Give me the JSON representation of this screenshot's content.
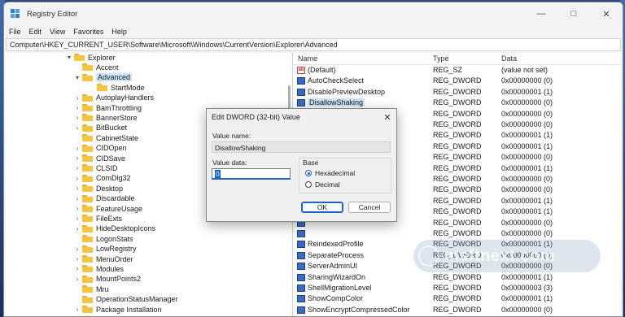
{
  "window": {
    "title": "Registry Editor",
    "controls": [
      "minimize",
      "maximize",
      "close"
    ]
  },
  "menu": [
    "File",
    "Edit",
    "View",
    "Favorites",
    "Help"
  ],
  "address": "Computer\\HKEY_CURRENT_USER\\Software\\Microsoft\\Windows\\CurrentVersion\\Explorer\\Advanced",
  "tree": {
    "items": [
      {
        "label": "Explorer",
        "chev": "▾"
      },
      {
        "label": "Accent",
        "chev": ""
      },
      {
        "label": "Advanced",
        "chev": "▾"
      },
      {
        "label": "StartMode",
        "chev": ""
      },
      {
        "label": "AutoplayHandlers",
        "chev": "›"
      },
      {
        "label": "BamThrottling",
        "chev": "›"
      },
      {
        "label": "BannerStore",
        "chev": "›"
      },
      {
        "label": "BitBucket",
        "chev": "›"
      },
      {
        "label": "CabinetState",
        "chev": ""
      },
      {
        "label": "CIDOpen",
        "chev": "›"
      },
      {
        "label": "CIDSave",
        "chev": "›"
      },
      {
        "label": "CLSID",
        "chev": "›"
      },
      {
        "label": "ComDlg32",
        "chev": "›"
      },
      {
        "label": "Desktop",
        "chev": "›"
      },
      {
        "label": "Discardable",
        "chev": "›"
      },
      {
        "label": "FeatureUsage",
        "chev": "›"
      },
      {
        "label": "FileExts",
        "chev": "›"
      },
      {
        "label": "HideDesktopIcons",
        "chev": "›"
      },
      {
        "label": "LogonStats",
        "chev": ""
      },
      {
        "label": "LowRegistry",
        "chev": "›"
      },
      {
        "label": "MenuOrder",
        "chev": "›"
      },
      {
        "label": "Modules",
        "chev": "›"
      },
      {
        "label": "MountPoints2",
        "chev": "›"
      },
      {
        "label": "Mru",
        "chev": ""
      },
      {
        "label": "OperationStatusManager",
        "chev": ""
      },
      {
        "label": "Package Installation",
        "chev": "›"
      }
    ]
  },
  "values_pane": {
    "headers": {
      "name": "Name",
      "type": "Type",
      "data": "Data"
    },
    "rows": [
      {
        "name": "(Default)",
        "type": "REG_SZ",
        "data": "(value not set)",
        "icon": "ab"
      },
      {
        "name": "AutoCheckSelect",
        "type": "REG_DWORD",
        "data": "0x00000000 (0)",
        "icon": "dword"
      },
      {
        "name": "DisablePreviewDesktop",
        "type": "REG_DWORD",
        "data": "0x00000001 (1)",
        "icon": "dword"
      },
      {
        "name": "DisallowShaking",
        "type": "REG_DWORD",
        "data": "0x00000000 (0)",
        "icon": "dword"
      },
      {
        "name": "",
        "type": "REG_DWORD",
        "data": "0x00000000 (0)",
        "icon": "dword"
      },
      {
        "name": "",
        "type": "REG_DWORD",
        "data": "0x00000000 (0)",
        "icon": "dword"
      },
      {
        "name": "",
        "type": "REG_DWORD",
        "data": "0x00000001 (1)",
        "icon": "dword"
      },
      {
        "name": "",
        "type": "REG_DWORD",
        "data": "0x00000001 (1)",
        "icon": "dword"
      },
      {
        "name": "",
        "type": "REG_DWORD",
        "data": "0x00000000 (0)",
        "icon": "dword"
      },
      {
        "name": "",
        "type": "REG_DWORD",
        "data": "0x00000001 (1)",
        "icon": "dword"
      },
      {
        "name": "",
        "type": "REG_DWORD",
        "data": "0x00000000 (0)",
        "icon": "dword"
      },
      {
        "name": "",
        "type": "REG_DWORD",
        "data": "0x00000000 (0)",
        "icon": "dword"
      },
      {
        "name": "",
        "type": "REG_DWORD",
        "data": "0x00000001 (1)",
        "icon": "dword"
      },
      {
        "name": "",
        "type": "REG_DWORD",
        "data": "0x00000001 (1)",
        "icon": "dword"
      },
      {
        "name": "",
        "type": "REG_DWORD",
        "data": "0x00000000 (0)",
        "icon": "dword"
      },
      {
        "name": "",
        "type": "REG_DWORD",
        "data": "0x00000000 (0)",
        "icon": "dword"
      },
      {
        "name": "ReindexedProfile",
        "type": "REG_DWORD",
        "data": "0x00000001 (1)",
        "icon": "dword"
      },
      {
        "name": "SeparateProcess",
        "type": "REG_DWORD",
        "data": "0x00000000 (0)",
        "icon": "dword"
      },
      {
        "name": "ServerAdminUI",
        "type": "REG_DWORD",
        "data": "0x00000000 (0)",
        "icon": "dword"
      },
      {
        "name": "SharingWizardOn",
        "type": "REG_DWORD",
        "data": "0x00000001 (1)",
        "icon": "dword"
      },
      {
        "name": "ShellMigrationLevel",
        "type": "REG_DWORD",
        "data": "0x00000003 (3)",
        "icon": "dword"
      },
      {
        "name": "ShowCompColor",
        "type": "REG_DWORD",
        "data": "0x00000001 (1)",
        "icon": "dword"
      },
      {
        "name": "ShowEncryptCompressedColor",
        "type": "REG_DWORD",
        "data": "0x00000000 (0)",
        "icon": "dword"
      }
    ]
  },
  "dialog": {
    "title": "Edit DWORD (32-bit) Value",
    "value_name_label": "Value name:",
    "value_name": "DisallowShaking",
    "value_data_label": "Value data:",
    "value_data": "0",
    "base_label": "Base",
    "hex_label": "Hexadecimal",
    "dec_label": "Decimal",
    "ok_label": "OK",
    "cancel_label": "Cancel"
  },
  "watermark": "msftnext.com"
}
